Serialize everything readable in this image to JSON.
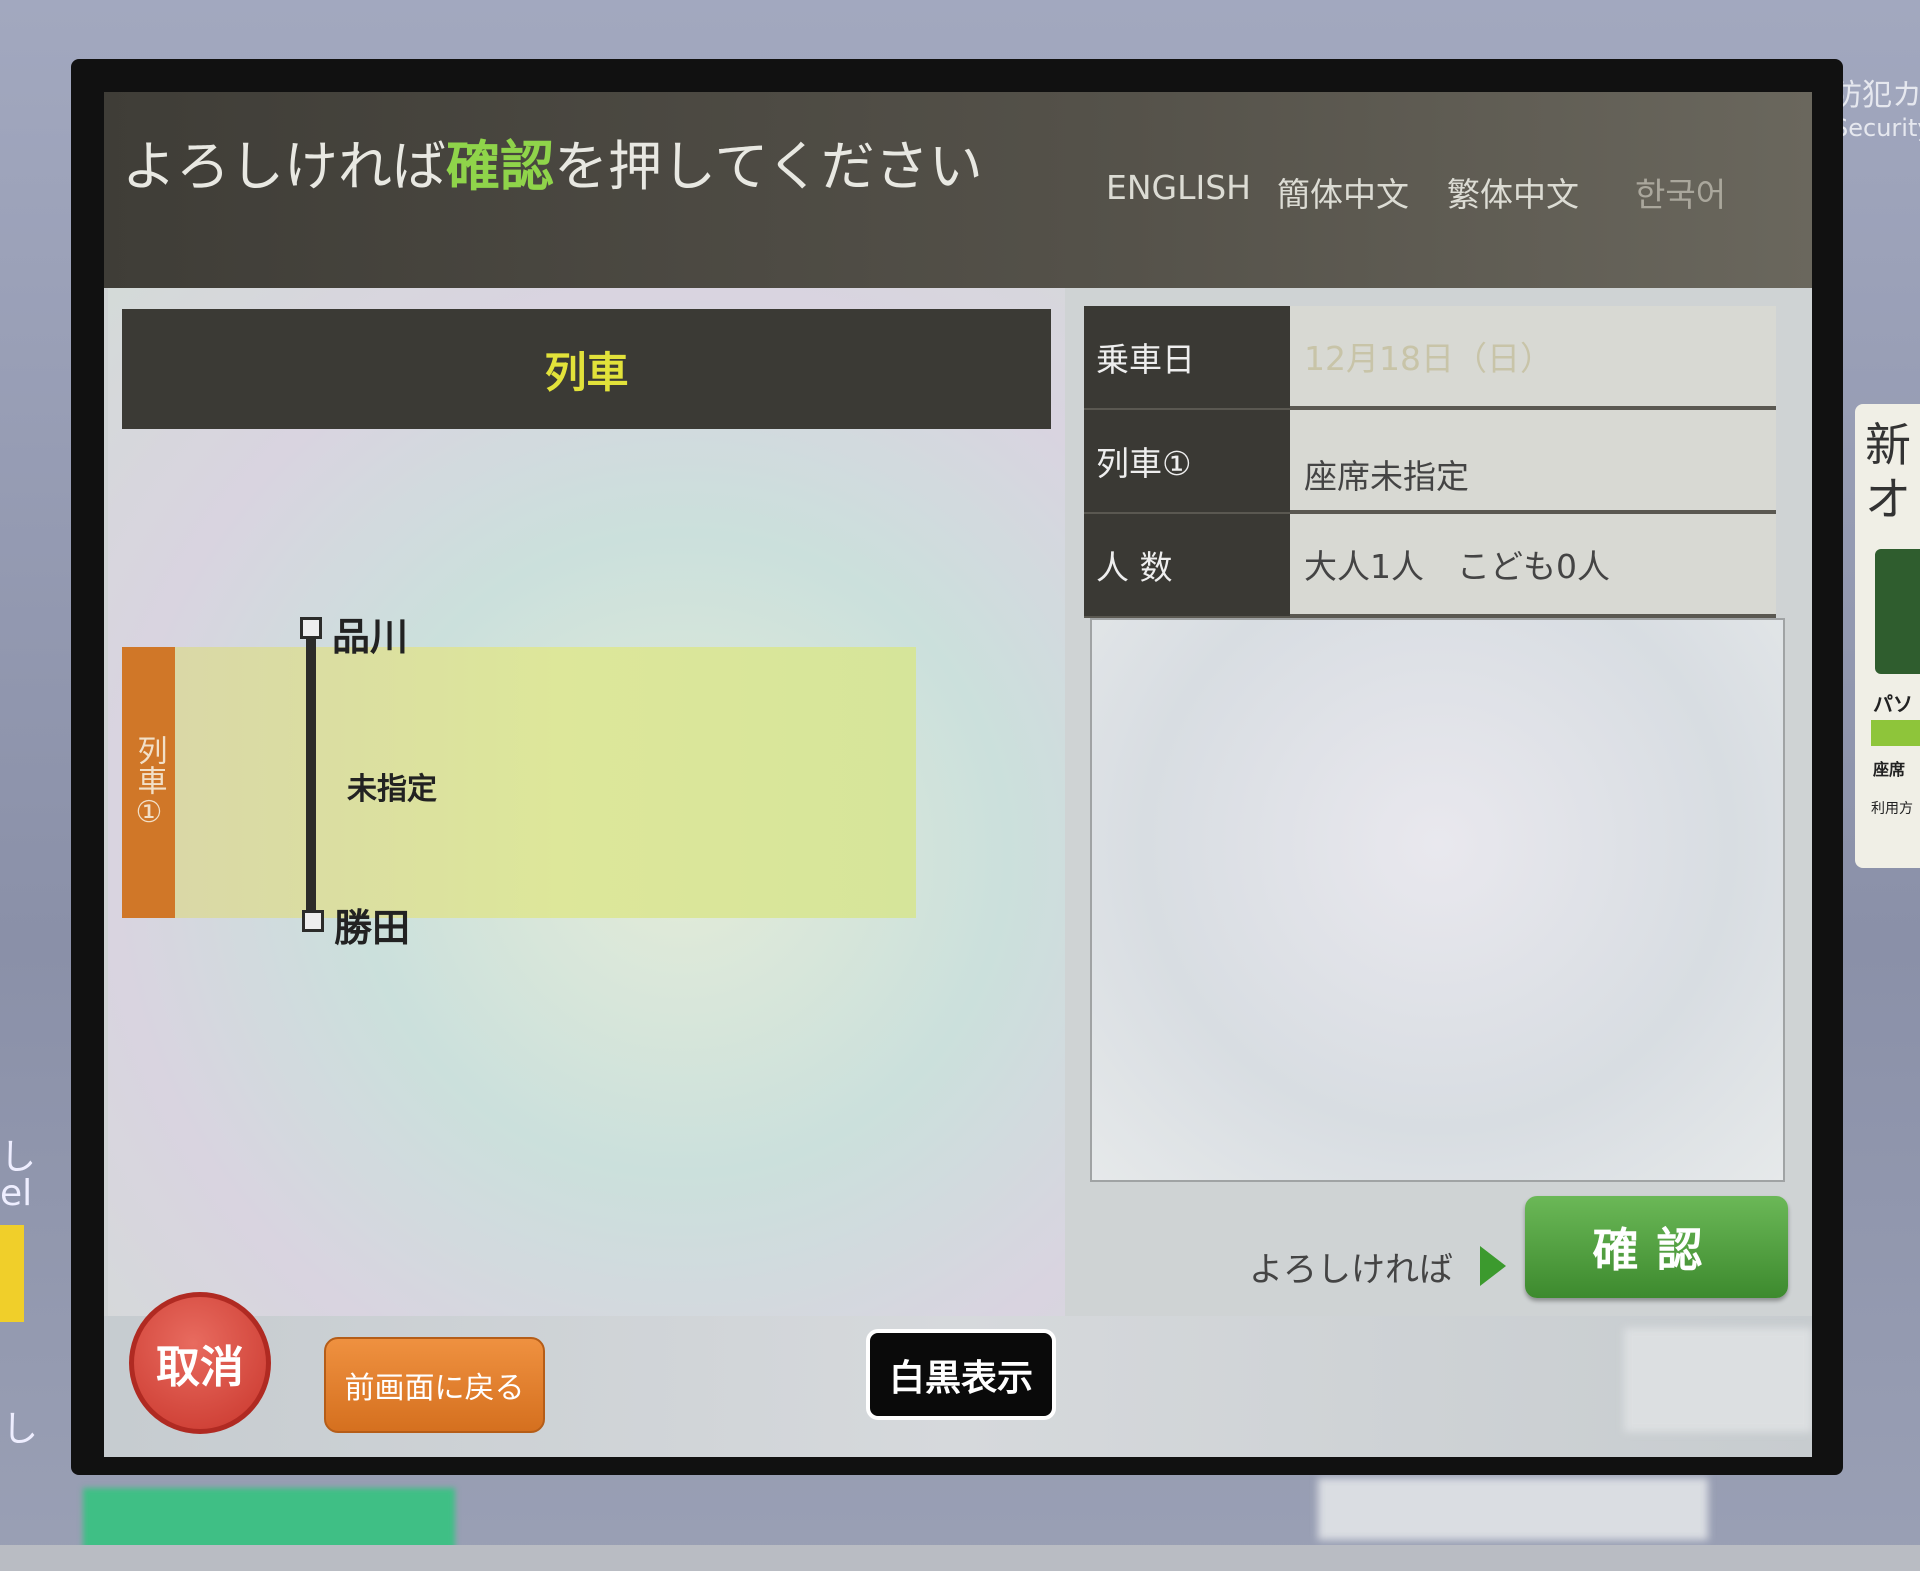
{
  "header": {
    "title_pre": "よろしければ",
    "title_highlight": "確認",
    "title_post": "を押してください",
    "languages": [
      "ENGLISH",
      "簡体中文",
      "繁体中文",
      "한국어"
    ]
  },
  "train_panel": {
    "heading": "列車",
    "train_tag": "列車①",
    "from_station": "品川",
    "to_station": "勝田",
    "seat_type": "未指定"
  },
  "info": {
    "rows": [
      {
        "label": "乗車日",
        "value": "12月18日（日）"
      },
      {
        "label": "列車①",
        "value": "座席未指定"
      },
      {
        "label": "人 数",
        "value": "大人1人　こども0人"
      }
    ]
  },
  "actions": {
    "ok_hint": "よろしければ",
    "ok_label": "確認",
    "cancel_label": "取消",
    "back_label": "前画面に戻る",
    "mono_label": "白黒表示"
  },
  "device": {
    "security_jp": "防犯カ",
    "security_en": "Security",
    "sticker_title": "新\nオ",
    "sticker_line1": "パソ",
    "sticker_line2": "座席",
    "sticker_line3": "利用方",
    "left_text1": "し\nel",
    "left_text2": "し"
  },
  "colors": {
    "highlight": "#8fd44a",
    "confirm_green": "#3d8a2e",
    "cancel_red": "#c9362c",
    "back_orange": "#d5701f",
    "train_tag_orange": "#d07728",
    "heading_yellow": "#e2e23a"
  }
}
